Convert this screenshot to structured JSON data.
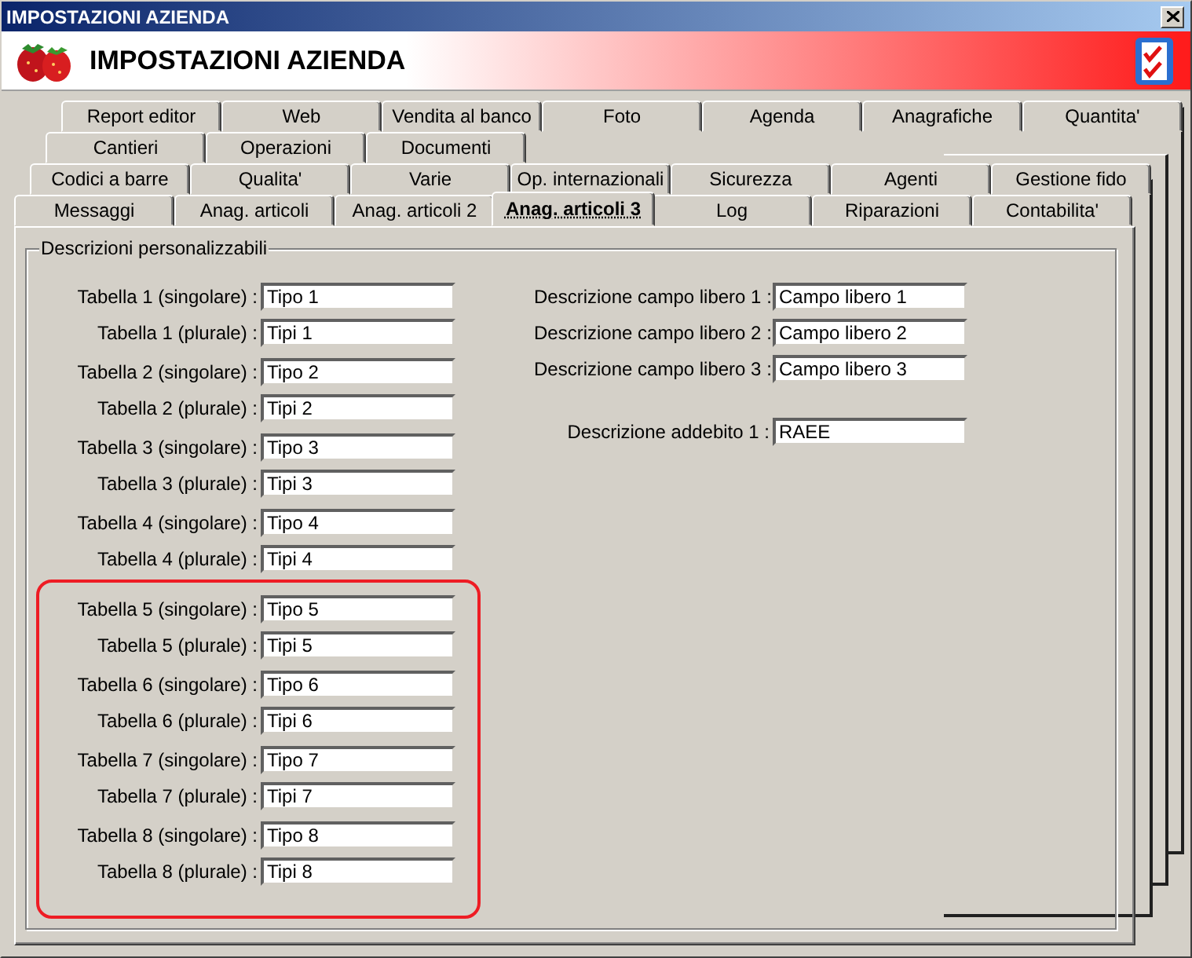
{
  "window": {
    "title": "IMPOSTAZIONI AZIENDA"
  },
  "header": {
    "title": "IMPOSTAZIONI AZIENDA"
  },
  "tab_rows": [
    {
      "tabs": [
        {
          "label": "Report editor",
          "selected": false
        },
        {
          "label": "Web",
          "selected": false
        },
        {
          "label": "Vendita al banco",
          "selected": false
        },
        {
          "label": "Foto",
          "selected": false
        },
        {
          "label": "Agenda",
          "selected": false
        },
        {
          "label": "Anagrafiche",
          "selected": false
        },
        {
          "label": "Quantita'",
          "selected": false
        }
      ]
    },
    {
      "tabs": [
        {
          "label": "Cantieri",
          "selected": false
        },
        {
          "label": "Operazioni",
          "selected": false
        },
        {
          "label": "Documenti",
          "selected": false
        }
      ]
    },
    {
      "tabs": [
        {
          "label": "Codici a barre",
          "selected": false
        },
        {
          "label": "Qualita'",
          "selected": false
        },
        {
          "label": "Varie",
          "selected": false
        },
        {
          "label": "Op. internazionali",
          "selected": false
        },
        {
          "label": "Sicurezza",
          "selected": false
        },
        {
          "label": "Agenti",
          "selected": false
        },
        {
          "label": "Gestione fido",
          "selected": false
        }
      ]
    },
    {
      "tabs": [
        {
          "label": "Messaggi",
          "selected": false
        },
        {
          "label": "Anag. articoli",
          "selected": false
        },
        {
          "label": "Anag. articoli 2",
          "selected": false
        },
        {
          "label": "Anag. articoli 3",
          "selected": true
        },
        {
          "label": "Log",
          "selected": false
        },
        {
          "label": "Riparazioni",
          "selected": false
        },
        {
          "label": "Contabilita'",
          "selected": false
        }
      ]
    }
  ],
  "group": {
    "title": "Descrizioni personalizzabili",
    "left_sections": [
      {
        "highlighted": false,
        "pairs": [
          {
            "fields": [
              {
                "label": "Tabella 1 (singolare) :",
                "value": "Tipo 1"
              },
              {
                "label": "Tabella 1 (plurale) :",
                "value": "Tipi 1"
              }
            ]
          },
          {
            "fields": [
              {
                "label": "Tabella 2 (singolare) :",
                "value": "Tipo 2"
              },
              {
                "label": "Tabella 2 (plurale) :",
                "value": "Tipi 2"
              }
            ]
          },
          {
            "fields": [
              {
                "label": "Tabella 3 (singolare) :",
                "value": "Tipo 3"
              },
              {
                "label": "Tabella 3 (plurale) :",
                "value": "Tipi 3"
              }
            ]
          },
          {
            "fields": [
              {
                "label": "Tabella 4 (singolare) :",
                "value": "Tipo 4"
              },
              {
                "label": "Tabella 4 (plurale) :",
                "value": "Tipi 4"
              }
            ]
          }
        ]
      },
      {
        "highlighted": true,
        "pairs": [
          {
            "fields": [
              {
                "label": "Tabella 5 (singolare) :",
                "value": "Tipo 5"
              },
              {
                "label": "Tabella 5 (plurale) :",
                "value": "Tipi 5"
              }
            ]
          },
          {
            "fields": [
              {
                "label": "Tabella 6 (singolare) :",
                "value": "Tipo 6"
              },
              {
                "label": "Tabella 6 (plurale) :",
                "value": "Tipi 6"
              }
            ]
          },
          {
            "fields": [
              {
                "label": "Tabella 7 (singolare) :",
                "value": "Tipo 7"
              },
              {
                "label": "Tabella 7 (plurale) :",
                "value": "Tipi 7"
              }
            ]
          },
          {
            "fields": [
              {
                "label": "Tabella 8 (singolare) :",
                "value": "Tipo 8"
              },
              {
                "label": "Tabella 8 (plurale) :",
                "value": "Tipi 8"
              }
            ]
          }
        ]
      }
    ],
    "right_groups": [
      {
        "fields": [
          {
            "label": "Descrizione campo libero 1 :",
            "value": "Campo libero 1"
          },
          {
            "label": "Descrizione campo libero 2 :",
            "value": "Campo libero 2"
          },
          {
            "label": "Descrizione campo libero 3 :",
            "value": "Campo libero 3"
          }
        ]
      },
      {
        "fields": [
          {
            "label": "Descrizione addebito 1 :",
            "value": "RAEE"
          }
        ]
      }
    ]
  }
}
